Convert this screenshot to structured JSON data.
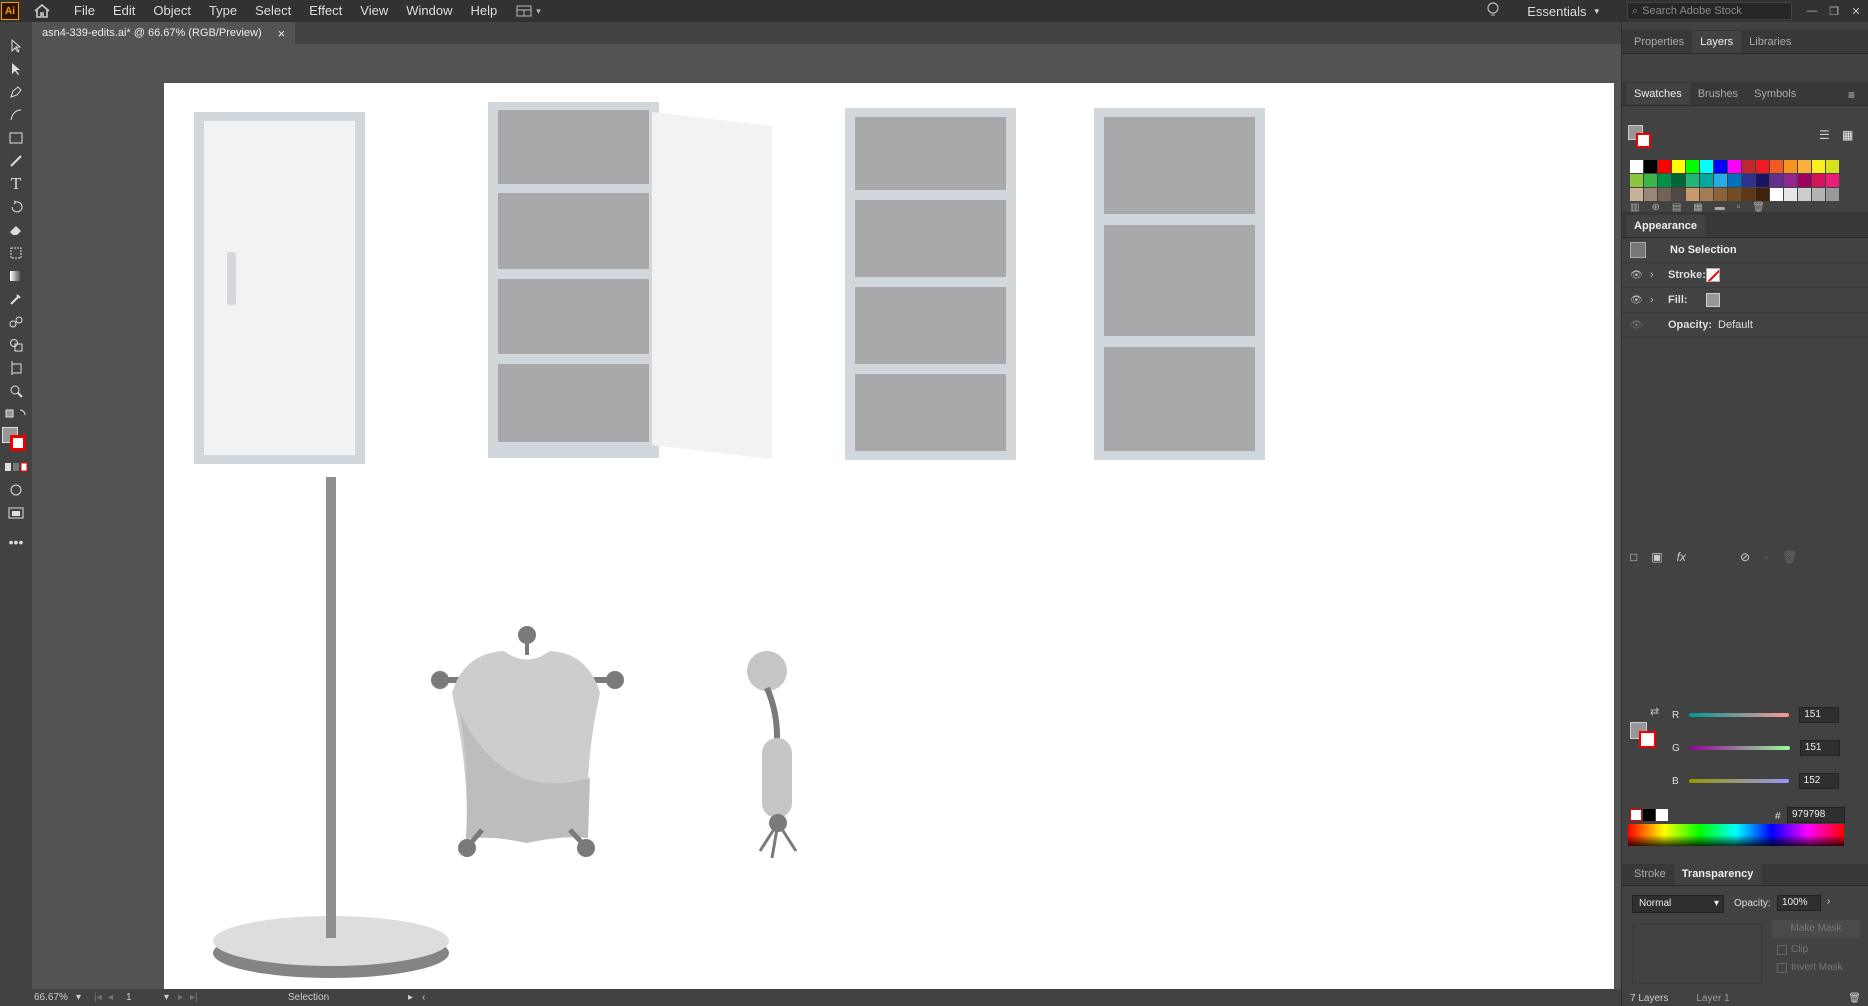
{
  "app": {
    "logo": "Ai",
    "home_icon": "home-icon"
  },
  "menu": [
    "File",
    "Edit",
    "Object",
    "Type",
    "Select",
    "Effect",
    "View",
    "Window",
    "Help"
  ],
  "workspace": {
    "label": "Essentials"
  },
  "search": {
    "placeholder": "Search Adobe Stock"
  },
  "document": {
    "tab_title": "asn4-339-edits.ai* @ 66.67% (RGB/Preview)",
    "close": "×"
  },
  "status": {
    "zoom": "66.67%",
    "artboard": "1",
    "tool": "Selection"
  },
  "panels": {
    "top_tabs": [
      "Properties",
      "Layers",
      "Libraries"
    ],
    "swatches_tabs": [
      "Swatches",
      "Brushes",
      "Symbols"
    ],
    "appearance": {
      "title": "Appearance",
      "selection": "No Selection",
      "stroke_label": "Stroke:",
      "fill_label": "Fill:",
      "opacity_label": "Opacity:",
      "opacity_value": "Default"
    },
    "color": {
      "R": "151",
      "G": "151",
      "B": "152",
      "hex": "979798",
      "hash": "#"
    },
    "bottom_tabs": [
      "Stroke",
      "Transparency"
    ],
    "transparency": {
      "blend_mode": "Normal",
      "opacity_label": "Opacity:",
      "opacity_value": "100%",
      "make_mask": "Make Mask",
      "clip": "Clip",
      "invert_mask": "Invert Mask",
      "layer_label": "Layer 1",
      "layers_count": "7 Layers"
    }
  },
  "swatch_colors": [
    "#ffffff",
    "#000000",
    "#ff0000",
    "#ffff00",
    "#00ff00",
    "#00ffff",
    "#0000ff",
    "#ff00ff",
    "#c1272d",
    "#ed1c24",
    "#f15a24",
    "#f7931e",
    "#fbb03b",
    "#fcee21",
    "#d9e021",
    "#8cc63f",
    "#39b54a",
    "#009245",
    "#006837",
    "#22b573",
    "#00a99d",
    "#29abe2",
    "#0071bc",
    "#2e3192",
    "#1b1464",
    "#662d91",
    "#93278f",
    "#9e005d",
    "#d4145a",
    "#ed1e79",
    "#c7b299",
    "#998675",
    "#736357",
    "#534741",
    "#c69c6d",
    "#a67c52",
    "#8c6239",
    "#754c24",
    "#603813",
    "#42210b",
    "#ffffff",
    "#e6e6e6",
    "#cccccc",
    "#b3b3b3",
    "#999999"
  ]
}
